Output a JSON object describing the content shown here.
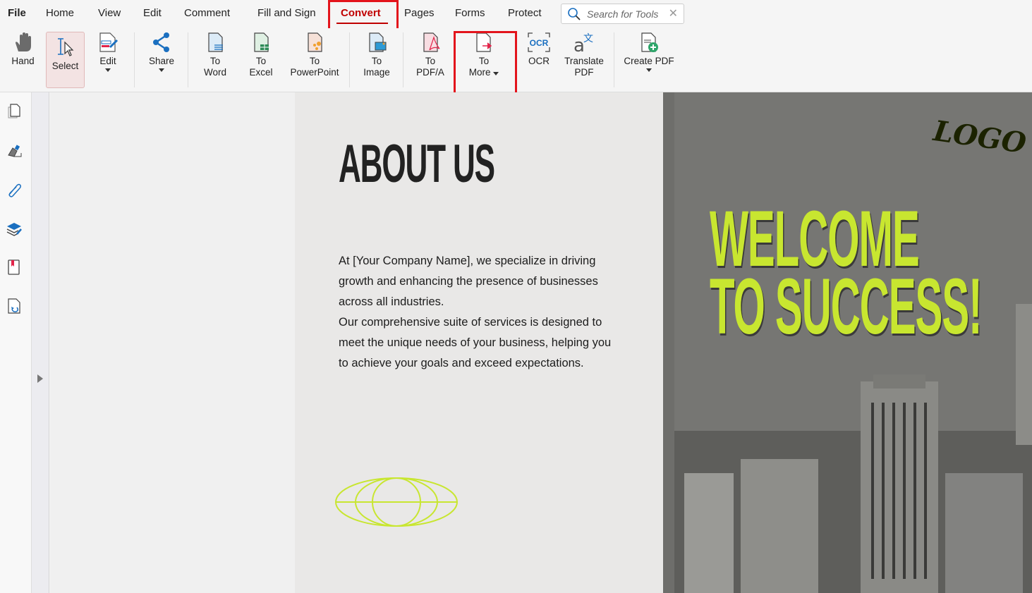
{
  "menu": {
    "items": [
      "File",
      "Home",
      "View",
      "Edit",
      "Comment",
      "Fill and Sign",
      "Convert",
      "Pages",
      "Forms",
      "Protect"
    ],
    "active": "Convert",
    "search_placeholder": "Search for Tools"
  },
  "toolbar": {
    "hand": "Hand",
    "select": "Select",
    "edit": "Edit",
    "share": "Share",
    "to_word": [
      "To",
      "Word"
    ],
    "to_excel": [
      "To",
      "Excel"
    ],
    "to_ppt": [
      "To",
      "PowerPoint"
    ],
    "to_image": [
      "To",
      "Image"
    ],
    "to_pdfa": [
      "To",
      "PDF/A"
    ],
    "to_more": [
      "To",
      "More"
    ],
    "ocr": "OCR",
    "translate": [
      "Translate",
      "PDF"
    ],
    "create_pdf": "Create PDF"
  },
  "sidebar": {
    "icons": [
      "pages-icon",
      "signature-icon",
      "attachment-icon",
      "layers-icon",
      "bookmark-icon",
      "replace-page-icon"
    ]
  },
  "document": {
    "heading": "ABOUT US",
    "paragraphs": [
      "At [Your Company Name], we specialize in driving growth and enhancing the presence of businesses across all industries.",
      "Our comprehensive suite of services is designed to meet the unique needs of your business, helping you to achieve your goals and exceed expectations."
    ],
    "welcome_lines": [
      "WELCOME",
      "TO SUCCESS!"
    ],
    "logo": "LOGO"
  },
  "colors": {
    "accent": "#c00000",
    "highlight": "#e3141c",
    "lime": "#c8e630"
  }
}
